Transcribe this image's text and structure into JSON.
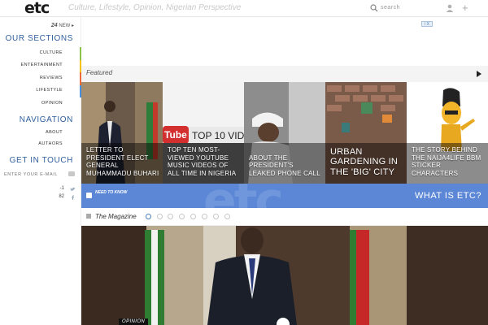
{
  "header": {
    "logo": "etc",
    "tagline": "Culture, Lifestyle, Opinion, Nigerian Perspective",
    "search_label": "search"
  },
  "sidebar": {
    "new_count": "24",
    "new_label": "NEW",
    "sections_title": "OUR SECTIONS",
    "sections": [
      "CULTURE",
      "ENTERTAINMENT",
      "REVIEWS",
      "LIFESTYLE",
      "OPINION"
    ],
    "section_colors": [
      "#8bc34a",
      "#f4c20d",
      "#ef6a3a",
      "#4a90e2"
    ],
    "navigation_title": "NAVIGATION",
    "navigation": [
      "ABOUT",
      "AUTHORS"
    ],
    "touch_title": "GET IN TOUCH",
    "email_placeholder": "ENTER YOUR E-MAIL",
    "twitter_count": "-1",
    "facebook_count": "82"
  },
  "featured": {
    "label": "Featured",
    "tiles": [
      {
        "caption": "LETTER TO PRESIDENT ELECT GENERAL MUHAMMADU BUHARI"
      },
      {
        "caption": "TOP TEN MOST-VIEWED YOUTUBE MUSIC VIDEOS OF ALL TIME IN NIGERIA",
        "overlay": "Tube",
        "overlay2": "TOP 10 VID"
      },
      {
        "caption": "ABOUT THE PRESIDENT'S LEAKED PHONE CALL"
      },
      {
        "caption": "URBAN GARDENING IN THE 'BIG' CITY"
      },
      {
        "caption": "THE STORY BEHIND THE NAIJA4LIFE BBM STICKER CHARACTERS"
      }
    ]
  },
  "need_to_know": {
    "label": "NEED TO KNOW",
    "watermark": "etc",
    "button": "WHAT IS ETC?"
  },
  "magazine": {
    "label": "The Magazine"
  },
  "hero": {
    "tag": "OPINION"
  },
  "ad": {
    "badge": "i X"
  },
  "colors": {
    "accent_blue": "#2f5f9e",
    "ntk_blue": "#5b87d6"
  }
}
